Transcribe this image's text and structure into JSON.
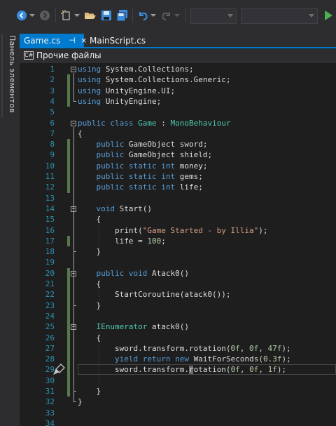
{
  "toolbar": {
    "buttons": [
      "back-icon",
      "forward-icon",
      "new-item-icon",
      "open-folder-icon",
      "save-icon",
      "save-all-icon",
      "undo-icon",
      "redo-icon",
      "start-icon"
    ],
    "dropdowns": [
      {
        "name": "configuration-dropdown",
        "value": ""
      },
      {
        "name": "platform-dropdown",
        "value": ""
      }
    ]
  },
  "sidepanel": {
    "label": "Панель элементов"
  },
  "tabs": [
    {
      "label": "Game.cs",
      "active": true,
      "pin": "⊣",
      "close": "×"
    },
    {
      "label": "MainScript.cs",
      "active": false
    }
  ],
  "navbar": {
    "icon_text": "C#",
    "label": "Прочие файлы"
  },
  "editor": {
    "current_line": 29,
    "lines": [
      {
        "n": "1",
        "text": "using System.Collections;"
      },
      {
        "n": "2",
        "text": "using System.Collections.Generic;"
      },
      {
        "n": "3",
        "text": "using UnityEngine.UI;"
      },
      {
        "n": "4",
        "text": "using UnityEngine;"
      },
      {
        "n": "5",
        "text": ""
      },
      {
        "n": "6",
        "text": "public class Game : MonoBehaviour"
      },
      {
        "n": "7",
        "text": "{"
      },
      {
        "n": "8",
        "text": "    public GameObject sword;"
      },
      {
        "n": "9",
        "text": "    public GameObject shield;"
      },
      {
        "n": "10",
        "text": "    public static int money;"
      },
      {
        "n": "11",
        "text": "    public static int gems;"
      },
      {
        "n": "12",
        "text": "    public static int life;"
      },
      {
        "n": "13",
        "text": ""
      },
      {
        "n": "14",
        "text": "    void Start()"
      },
      {
        "n": "15",
        "text": "    {"
      },
      {
        "n": "16",
        "text": "        print(\"Game Started - by Illia\");"
      },
      {
        "n": "17",
        "text": "        life = 100;"
      },
      {
        "n": "18",
        "text": "    }"
      },
      {
        "n": "19",
        "text": ""
      },
      {
        "n": "20",
        "text": "    public void Atack0()"
      },
      {
        "n": "21",
        "text": "    {"
      },
      {
        "n": "22",
        "text": "        StartCoroutine(atack0());"
      },
      {
        "n": "23",
        "text": "    }"
      },
      {
        "n": "24",
        "text": ""
      },
      {
        "n": "25",
        "text": "    IEnumerator atack0()"
      },
      {
        "n": "26",
        "text": "    {"
      },
      {
        "n": "27",
        "text": "        sword.transform.rotation(0f, 0f, 47f);"
      },
      {
        "n": "28",
        "text": "        yield return new WaitForSeconds(0.3f);"
      },
      {
        "n": "29",
        "text": "        sword.transform.rotation(0f, 0f, 1f);"
      },
      {
        "n": "30",
        "text": ""
      },
      {
        "n": "31",
        "text": "    }"
      },
      {
        "n": "32",
        "text": "}"
      },
      {
        "n": "33",
        "text": ""
      },
      {
        "n": "34",
        "text": ""
      }
    ]
  },
  "colors": {
    "keyword": "#569cd6",
    "type": "#4ec9b0",
    "string": "#d69d85",
    "number": "#b5cea8",
    "line_number": "#2b91af",
    "accent": "#007acc",
    "change_bar": "#57784a"
  }
}
